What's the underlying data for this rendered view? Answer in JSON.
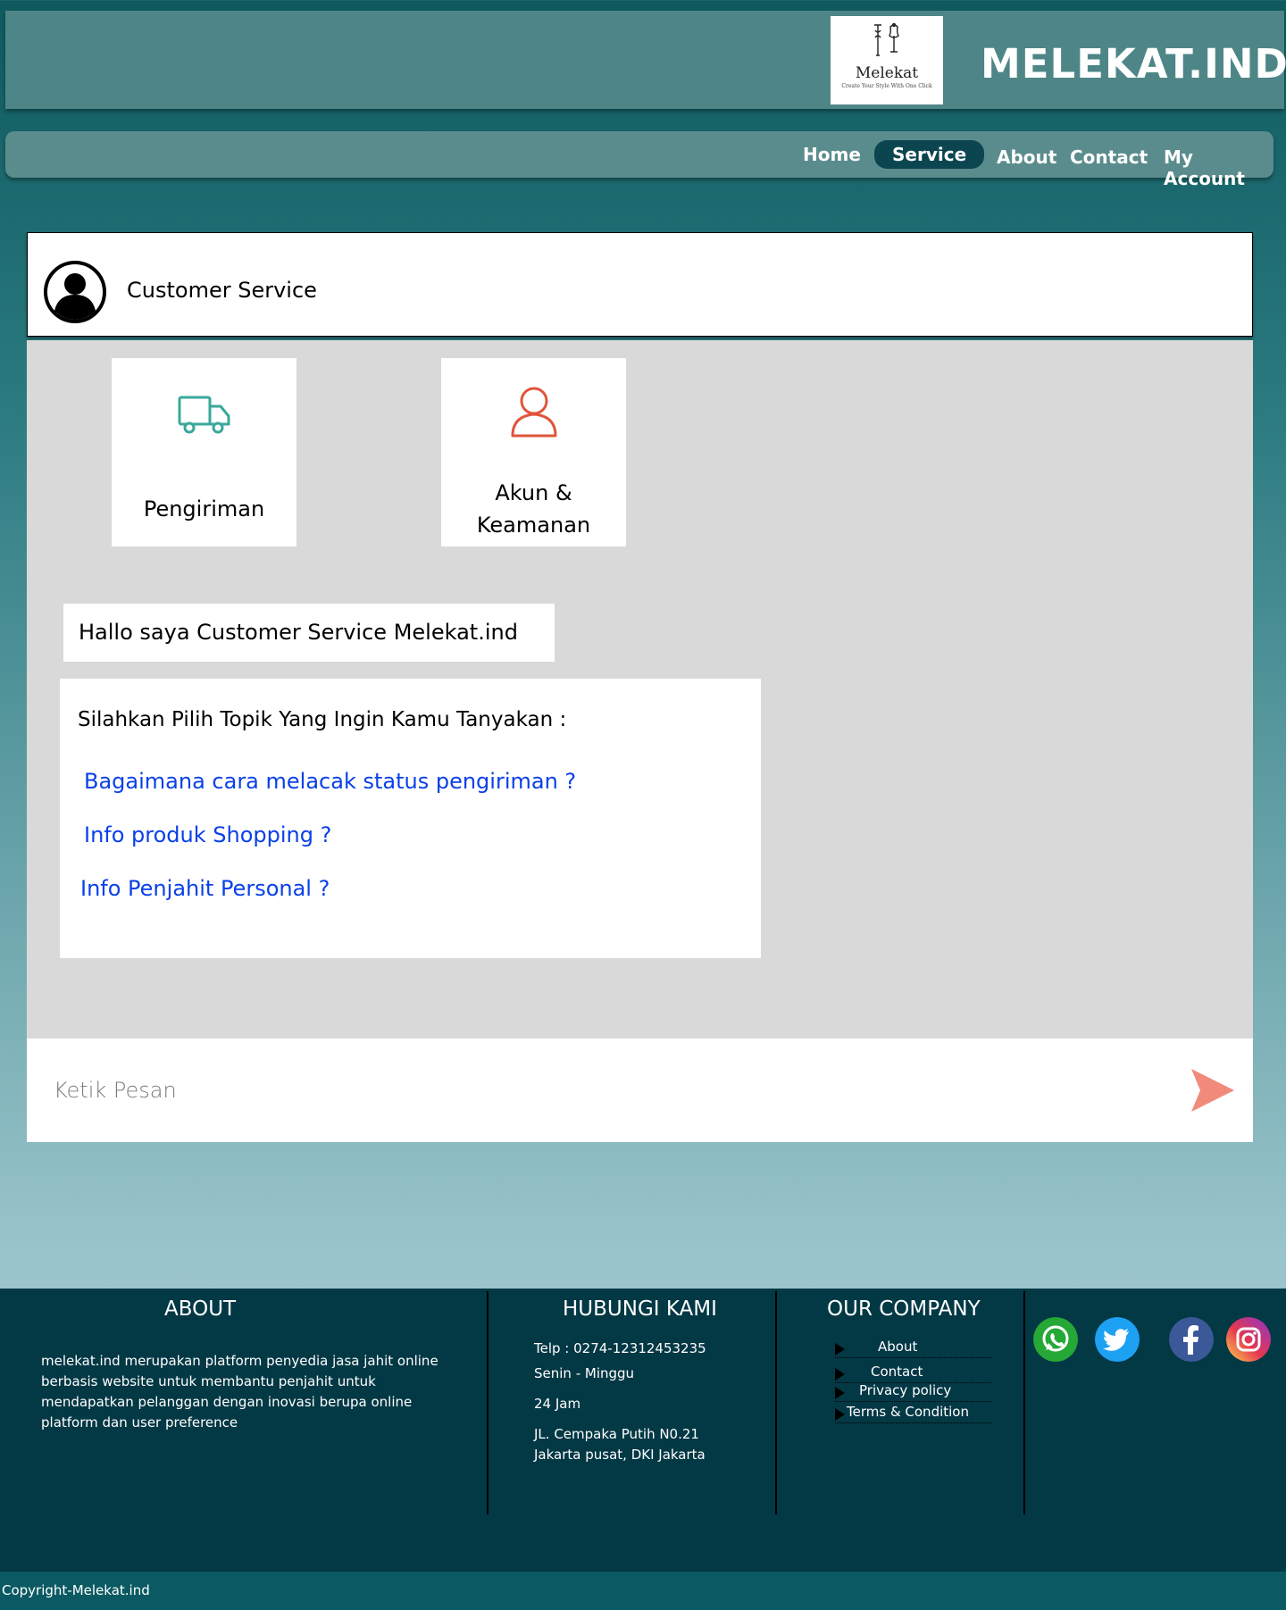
{
  "header": {
    "logo_name": "Melekat",
    "logo_tagline": "Create Your Style With One Click",
    "brand": "MELEKAT.IND"
  },
  "nav": {
    "items": [
      {
        "label": "Home",
        "active": false
      },
      {
        "label": "Service",
        "active": true
      },
      {
        "label": "About",
        "active": false
      },
      {
        "label": "Contact",
        "active": false
      },
      {
        "label": "My Account",
        "active": false
      }
    ]
  },
  "chat": {
    "title": "Customer Service",
    "tiles": [
      {
        "label": "Pengiriman",
        "icon": "truck-icon",
        "color": "#3aa89a"
      },
      {
        "label_line1": "Akun &",
        "label_line2": "Keamanan",
        "icon": "user-icon",
        "color": "#e0553a"
      }
    ],
    "greeting": "Hallo saya Customer Service Melekat.ind",
    "topic_prompt": "Silahkan Pilih Topik  Yang Ingin Kamu Tanyakan :",
    "topics": [
      "Bagaimana cara melacak status pengiriman ?",
      "Info produk Shopping ?",
      "Info Penjahit Personal ?"
    ],
    "input_placeholder": "Ketik Pesan",
    "send_color": "#f08070"
  },
  "footer": {
    "about_head": "ABOUT",
    "about_lines": [
      "melekat.ind merupakan platform penyedia jasa jahit online",
      "berbasis website untuk membantu penjahit untuk",
      "mendapatkan pelanggan dengan inovasi berupa online",
      "platform dan user preference"
    ],
    "contact_head": "HUBUNGI KAMI",
    "telp": "Telp  :  0274-12312453235",
    "days": "Senin - Minggu",
    "hours": "24 Jam",
    "address_line1": "JL. Cempaka Putih N0.21",
    "address_line2": "Jakarta pusat, DKI Jakarta",
    "company_head": "OUR COMPANY",
    "company_links": [
      "About",
      "Contact",
      "Privacy policy",
      "Terms & Condition"
    ],
    "social": [
      "whatsapp-icon",
      "twitter-icon",
      "facebook-icon",
      "instagram-icon"
    ],
    "copyright": "Copyright-Melekat.ind"
  }
}
